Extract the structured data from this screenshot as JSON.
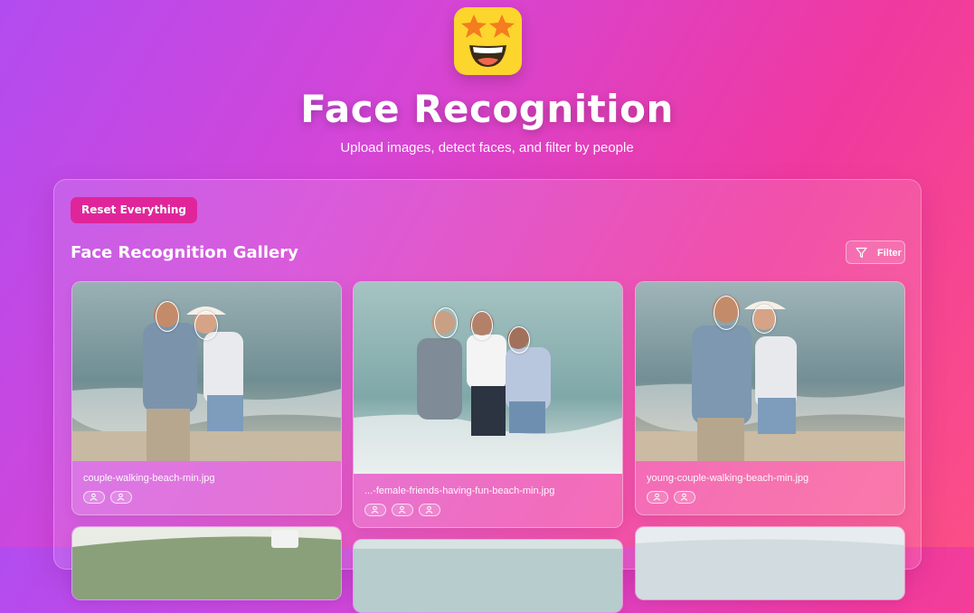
{
  "header": {
    "logo_icon": "star-struck-face-icon",
    "title": "Face Recognition",
    "subtitle": "Upload images, detect faces, and filter by people"
  },
  "toolbar": {
    "reset_label": "Reset Everything",
    "gallery_title": "Face Recognition Gallery",
    "filter_label": "Filter",
    "filter_icon": "filter-funnel-icon"
  },
  "gallery": {
    "items": [
      {
        "filename": "couple-walking-beach-min.jpg",
        "faces": 2
      },
      {
        "filename": "...-female-friends-having-fun-beach-min.jpg",
        "faces": 3
      },
      {
        "filename": "young-couple-walking-beach-min.jpg",
        "faces": 2
      }
    ]
  },
  "colors": {
    "accent": "#e0259a",
    "logo_bg": "#fcd52d",
    "bg_start": "#b24cf0",
    "bg_end": "#fb4f86"
  }
}
